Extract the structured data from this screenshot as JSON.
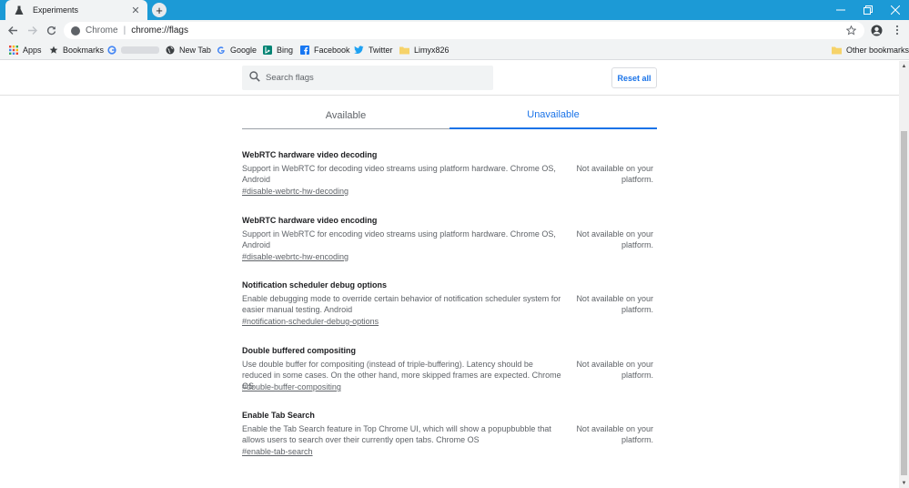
{
  "browser": {
    "tab_title": "Experiments",
    "tab_close": "✕",
    "new_tab": "+",
    "omnibox_origin": "Chrome",
    "omnibox_separator": "|",
    "omnibox_path": "chrome://flags"
  },
  "bookmarks": [
    {
      "label": "Apps",
      "icon": "apps-grid-icon"
    },
    {
      "label": "Bookmarks",
      "icon": "star-icon"
    },
    {
      "label": "",
      "icon": "google-icon"
    },
    {
      "label": "New Tab",
      "icon": "globe-icon"
    },
    {
      "label": "Google",
      "icon": "google-icon"
    },
    {
      "label": "Bing",
      "icon": "bing-icon"
    },
    {
      "label": "Facebook",
      "icon": "facebook-icon"
    },
    {
      "label": "Twitter",
      "icon": "twitter-icon"
    },
    {
      "label": "Limyx826",
      "icon": "folder-icon"
    }
  ],
  "other_bookmarks": "Other bookmarks",
  "page": {
    "search_placeholder": "Search flags",
    "reset_label": "Reset all",
    "tab_available": "Available",
    "tab_unavailable": "Unavailable"
  },
  "flags": [
    {
      "name": "WebRTC hardware video decoding",
      "description": "Support in WebRTC for decoding video streams using platform hardware. Chrome OS, Android",
      "link": "#disable-webrtc-hw-decoding",
      "status": "Not available on your platform."
    },
    {
      "name": "WebRTC hardware video encoding",
      "description": "Support in WebRTC for encoding video streams using platform hardware. Chrome OS, Android",
      "link": "#disable-webrtc-hw-encoding",
      "status": "Not available on your platform."
    },
    {
      "name": "Notification scheduler debug options",
      "description": "Enable debugging mode to override certain behavior of notification scheduler system for easier manual testing. Android",
      "link": "#notification-scheduler-debug-options",
      "status": "Not available on your platform."
    },
    {
      "name": "Double buffered compositing",
      "description": "Use double buffer for compositing (instead of triple-buffering). Latency should be reduced in some cases. On the other hand, more skipped frames are expected. Chrome OS",
      "link": "#double-buffer-compositing",
      "status": "Not available on your platform."
    },
    {
      "name": "Enable Tab Search",
      "description": "Enable the Tab Search feature in Top Chrome UI, which will show a popupbubble that allows users to search over their currently open tabs. Chrome OS",
      "link": "#enable-tab-search",
      "status": "Not available on your platform."
    }
  ],
  "colors": {
    "titlebar": "#1c9ad6",
    "accent": "#1a73e8"
  }
}
